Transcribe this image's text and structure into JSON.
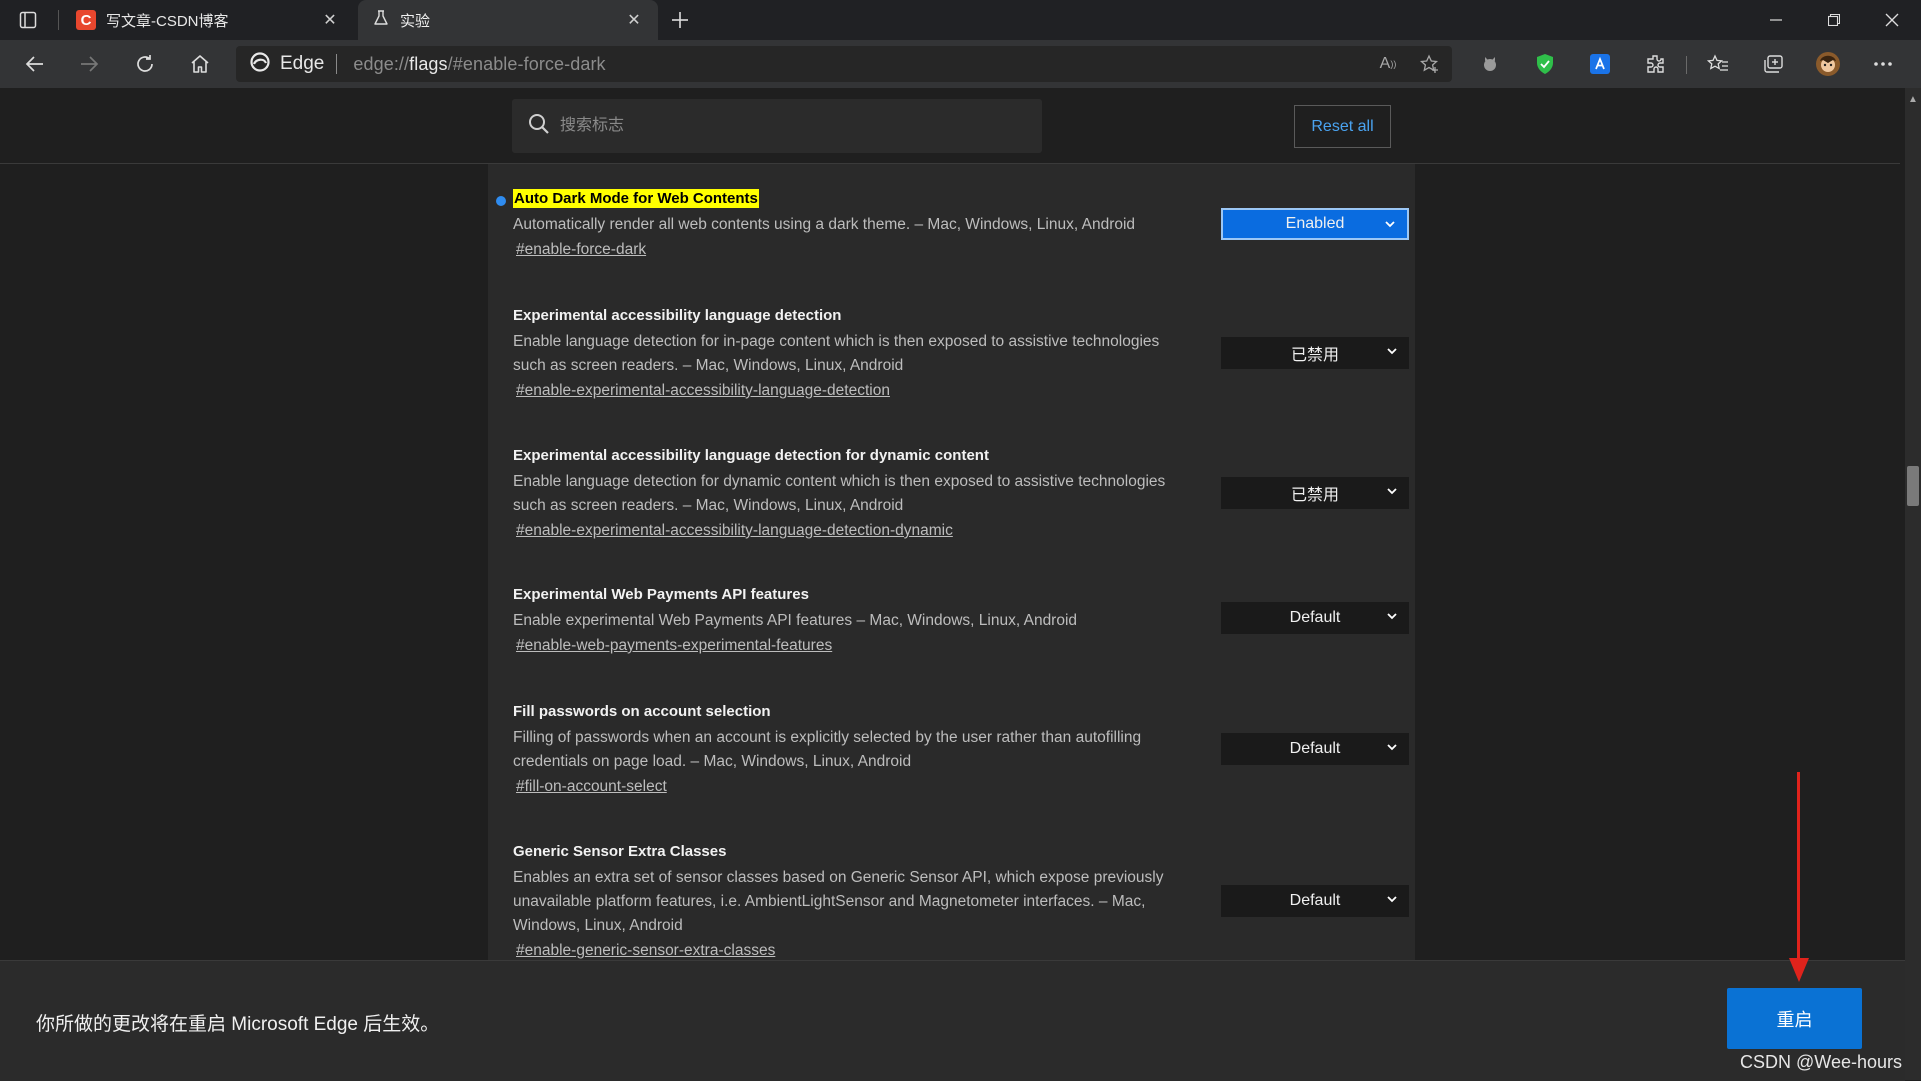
{
  "tabs": [
    {
      "title": "写文章-CSDN博客",
      "favicon": "csdn-logo-icon"
    },
    {
      "title": "实验",
      "favicon": "flask-icon"
    }
  ],
  "address_bar": {
    "brand": "Edge",
    "url_prefix": "edge://",
    "url_host": "flags",
    "url_hash": "/#enable-force-dark"
  },
  "search": {
    "placeholder": "搜索标志",
    "reset_label": "Reset all"
  },
  "flags": [
    {
      "name": "Auto Dark Mode for Web Contents",
      "description": "Automatically render all web contents using a dark theme. – Mac, Windows, Linux, Android",
      "link": "#enable-force-dark",
      "value": "Enabled",
      "highlighted": true
    },
    {
      "name": "Experimental accessibility language detection",
      "description": "Enable language detection for in-page content which is then exposed to assistive technologies such as screen readers. – Mac, Windows, Linux, Android",
      "link": "#enable-experimental-accessibility-language-detection",
      "value": "已禁用"
    },
    {
      "name": "Experimental accessibility language detection for dynamic content",
      "description": "Enable language detection for dynamic content which is then exposed to assistive technologies such as screen readers. – Mac, Windows, Linux, Android",
      "link": "#enable-experimental-accessibility-language-detection-dynamic",
      "value": "已禁用"
    },
    {
      "name": "Experimental Web Payments API features",
      "description": "Enable experimental Web Payments API features – Mac, Windows, Linux, Android",
      "link": "#enable-web-payments-experimental-features",
      "value": "Default"
    },
    {
      "name": "Fill passwords on account selection",
      "description": "Filling of passwords when an account is explicitly selected by the user rather than autofilling credentials on page load. – Mac, Windows, Linux, Android",
      "link": "#fill-on-account-select",
      "value": "Default"
    },
    {
      "name": "Generic Sensor Extra Classes",
      "description": "Enables an extra set of sensor classes based on Generic Sensor API, which expose previously unavailable platform features, i.e. AmbientLightSensor and Magnetometer interfaces. – Mac, Windows, Linux, Android",
      "link": "#enable-generic-sensor-extra-classes",
      "value": "Default"
    }
  ],
  "footer": {
    "message": "你所做的更改将在重启 Microsoft Edge 后生效。",
    "relaunch_label": "重启"
  },
  "watermark": "CSDN @Wee-hours",
  "colors": {
    "accent": "#0a72d4",
    "highlight": "#ffff00",
    "annotation_arrow": "#e0231c"
  }
}
